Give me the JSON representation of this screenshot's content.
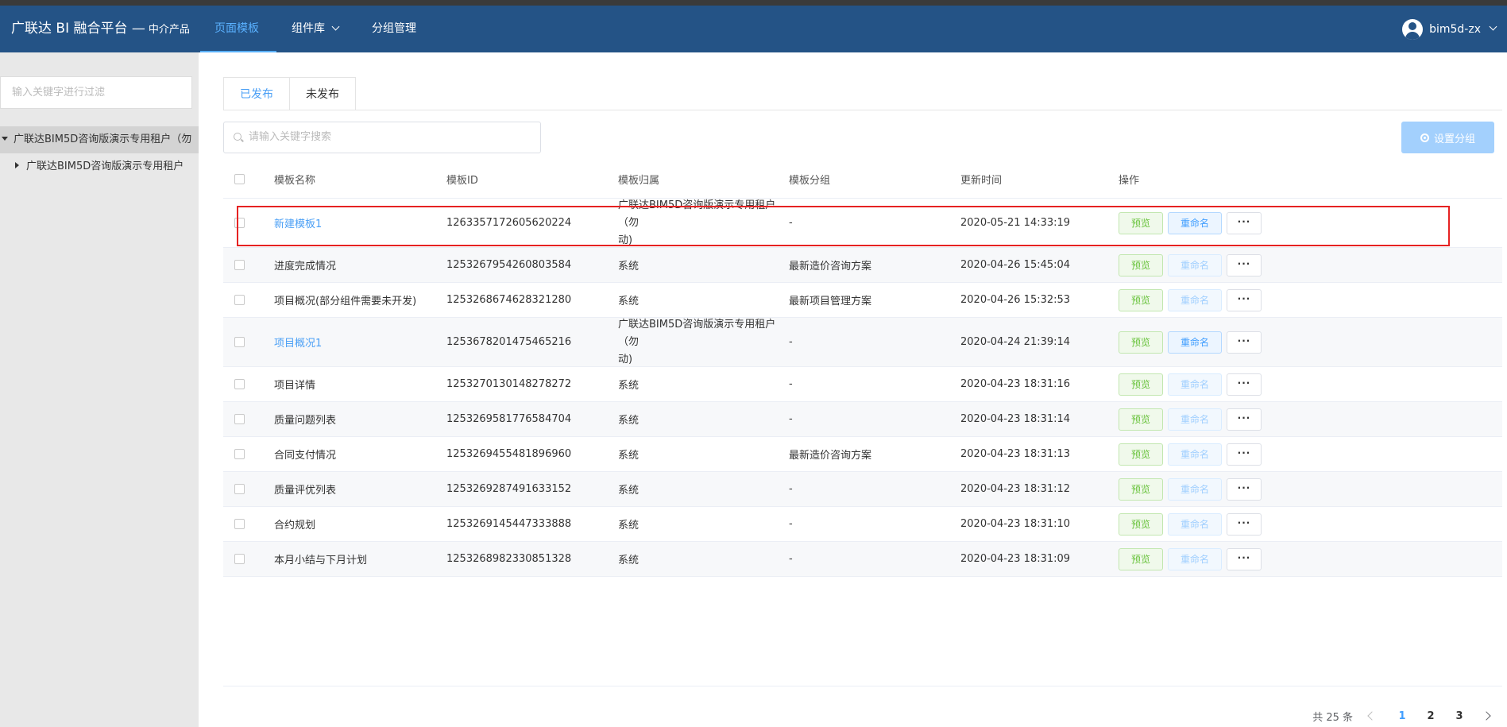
{
  "header": {
    "brand": "广联达 BI 融合平台 —",
    "brand_sub": "中介产品",
    "nav": [
      {
        "label": "页面模板",
        "active": true
      },
      {
        "label": "组件库",
        "dropdown": true
      },
      {
        "label": "分组管理"
      }
    ],
    "user": "bim5d-zx"
  },
  "sidebar": {
    "filter_placeholder": "输入关键字进行过滤",
    "tree": [
      {
        "label": "广联达BIM5D咨询版演示专用租户（勿",
        "expanded": true,
        "selected": true
      },
      {
        "label": "广联达BIM5D咨询版演示专用租户",
        "expanded": false
      }
    ]
  },
  "main": {
    "tabs": [
      {
        "label": "已发布",
        "active": true
      },
      {
        "label": "未发布"
      }
    ],
    "search_placeholder": "请输入关键字搜索",
    "group_button": "设置分组",
    "table": {
      "columns": [
        "模板名称",
        "模板ID",
        "模板归属",
        "模板分组",
        "更新时间",
        "操作"
      ],
      "actions": {
        "preview": "预览",
        "rename": "重命名",
        "more": "···"
      },
      "rows": [
        {
          "name": "新建模板1",
          "id": "1263357172605620224",
          "owner": "广联达BIM5D咨询版演示专用租户（勿",
          "owner2": "动)",
          "group": "-",
          "time": "2020-05-21 14:33:19",
          "link": true,
          "rename_enabled": true,
          "tall": true
        },
        {
          "name": "进度完成情况",
          "id": "1253267954260803584",
          "owner": "系统",
          "group": "最新造价咨询方案",
          "time": "2020-04-26 15:45:04"
        },
        {
          "name": "项目概况(部分组件需要未开发)",
          "id": "1253268674628321280",
          "owner": "系统",
          "group": "最新项目管理方案",
          "time": "2020-04-26 15:32:53"
        },
        {
          "name": "项目概况1",
          "id": "1253678201475465216",
          "owner": "广联达BIM5D咨询版演示专用租户（勿",
          "owner2": "动)",
          "group": "-",
          "time": "2020-04-24 21:39:14",
          "link": true,
          "rename_enabled": true,
          "tall": true
        },
        {
          "name": "项目详情",
          "id": "1253270130148278272",
          "owner": "系统",
          "group": "-",
          "time": "2020-04-23 18:31:16"
        },
        {
          "name": "质量问题列表",
          "id": "1253269581776584704",
          "owner": "系统",
          "group": "-",
          "time": "2020-04-23 18:31:14"
        },
        {
          "name": "合同支付情况",
          "id": "1253269455481896960",
          "owner": "系统",
          "group": "最新造价咨询方案",
          "time": "2020-04-23 18:31:13"
        },
        {
          "name": "质量评优列表",
          "id": "1253269287491633152",
          "owner": "系统",
          "group": "-",
          "time": "2020-04-23 18:31:12"
        },
        {
          "name": "合约规划",
          "id": "1253269145447333888",
          "owner": "系统",
          "group": "-",
          "time": "2020-04-23 18:31:10"
        },
        {
          "name": "本月小结与下月计划",
          "id": "1253268982330851328",
          "owner": "系统",
          "group": "-",
          "time": "2020-04-23 18:31:09"
        }
      ]
    },
    "pagination": {
      "total": "共 25 条",
      "pages": [
        "1",
        "2",
        "3"
      ],
      "current": "1"
    }
  },
  "colors": {
    "header_bg": "#245386",
    "accent": "#409eff",
    "highlight_box": "#e62222"
  }
}
